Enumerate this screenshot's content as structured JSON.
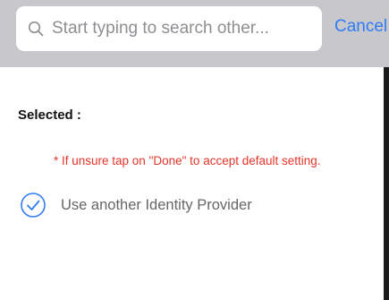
{
  "search": {
    "placeholder": "Start typing to search other...",
    "cancel_label": "Cancel"
  },
  "section": {
    "selected_label": "Selected :",
    "hint": "* If unsure tap on \"Done\" to accept default  setting."
  },
  "option": {
    "label": "Use another Identity Provider",
    "checked": true
  },
  "icons": {
    "search": "search-icon",
    "check": "check-circle-icon"
  },
  "colors": {
    "accent": "#2f7cf6",
    "hint": "#e5352b",
    "bar": "#c7c7cc"
  }
}
